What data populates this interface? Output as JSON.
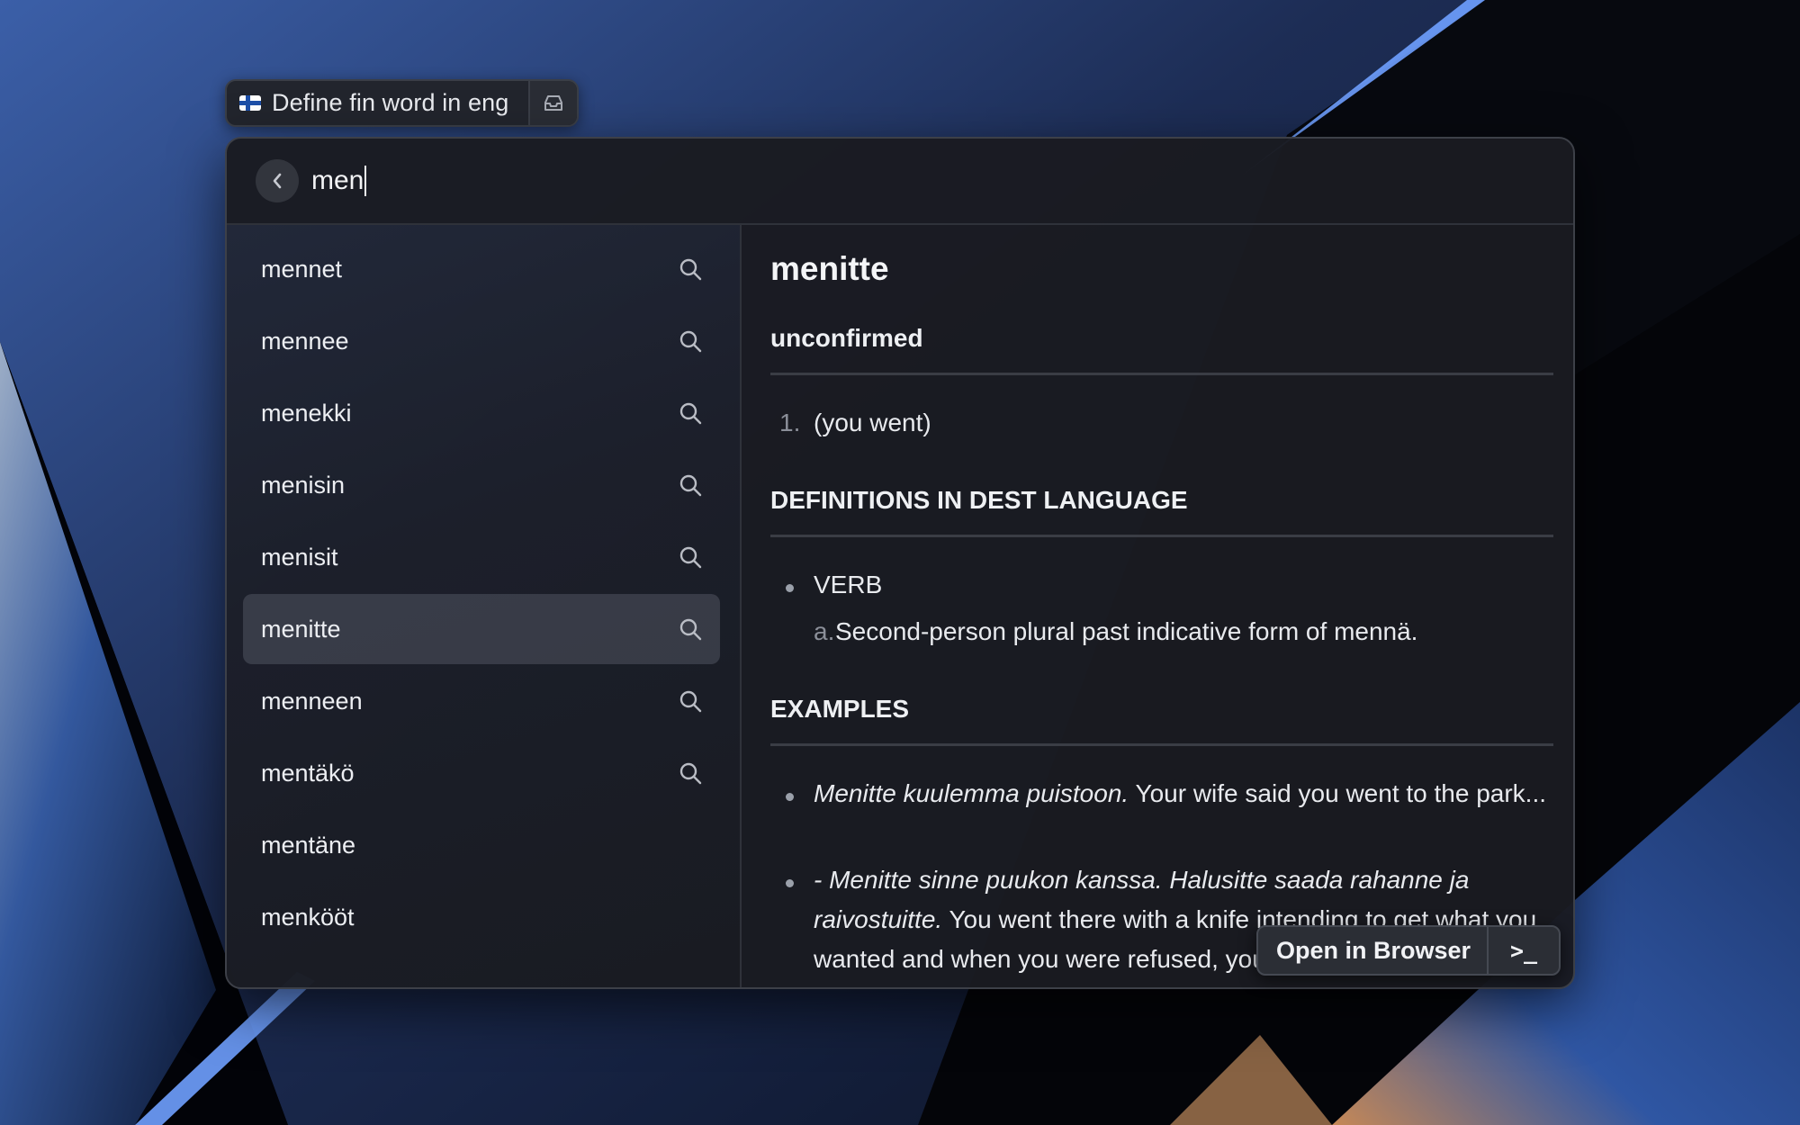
{
  "command": {
    "flag_icon": "finnish-flag-icon",
    "title": "Define fin word in eng",
    "action_icon": "inbox-tray-icon"
  },
  "search": {
    "back_icon": "chevron-left-icon",
    "value": "men"
  },
  "results": {
    "items": [
      {
        "label": "mennet",
        "icon": "search-icon"
      },
      {
        "label": "mennee",
        "icon": "search-icon"
      },
      {
        "label": "menekki",
        "icon": "search-icon"
      },
      {
        "label": "menisin",
        "icon": "search-icon"
      },
      {
        "label": "menisit",
        "icon": "search-icon"
      },
      {
        "label": "menitte",
        "icon": "search-icon",
        "selected": true
      },
      {
        "label": "menneen",
        "icon": "search-icon"
      },
      {
        "label": "mentäkö",
        "icon": "search-icon"
      },
      {
        "label": "mentäne"
      },
      {
        "label": "menkööt"
      }
    ]
  },
  "detail": {
    "word": "menitte",
    "status_heading": "unconfirmed",
    "translations": [
      {
        "marker": "1.",
        "text": "(you went)"
      }
    ],
    "definitions_heading": "DEFINITIONS IN DEST LANGUAGE",
    "definitions": [
      {
        "pos": "VERB",
        "senses": [
          {
            "marker": "a.",
            "text": "Second-person plural past indicative form of mennä."
          }
        ]
      }
    ],
    "examples_heading": "EXAMPLES",
    "examples": [
      {
        "finnish": "Menitte kuulemma puistoon.",
        "english": " Your wife said you went to the park..."
      },
      {
        "finnish": "- Menitte sinne puukon kanssa. Halusitte saada rahanne ja raivostuitte.",
        "english": " You went there with a knife intending to get what you wanted and when you were refused, you got angry."
      }
    ]
  },
  "footer": {
    "open_label": "Open in Browser",
    "terminal_label": ">_"
  },
  "colors": {
    "window_bg": "#1a1b21",
    "selected_row": "#50545f",
    "accent_blue": "#1d4fa8"
  }
}
